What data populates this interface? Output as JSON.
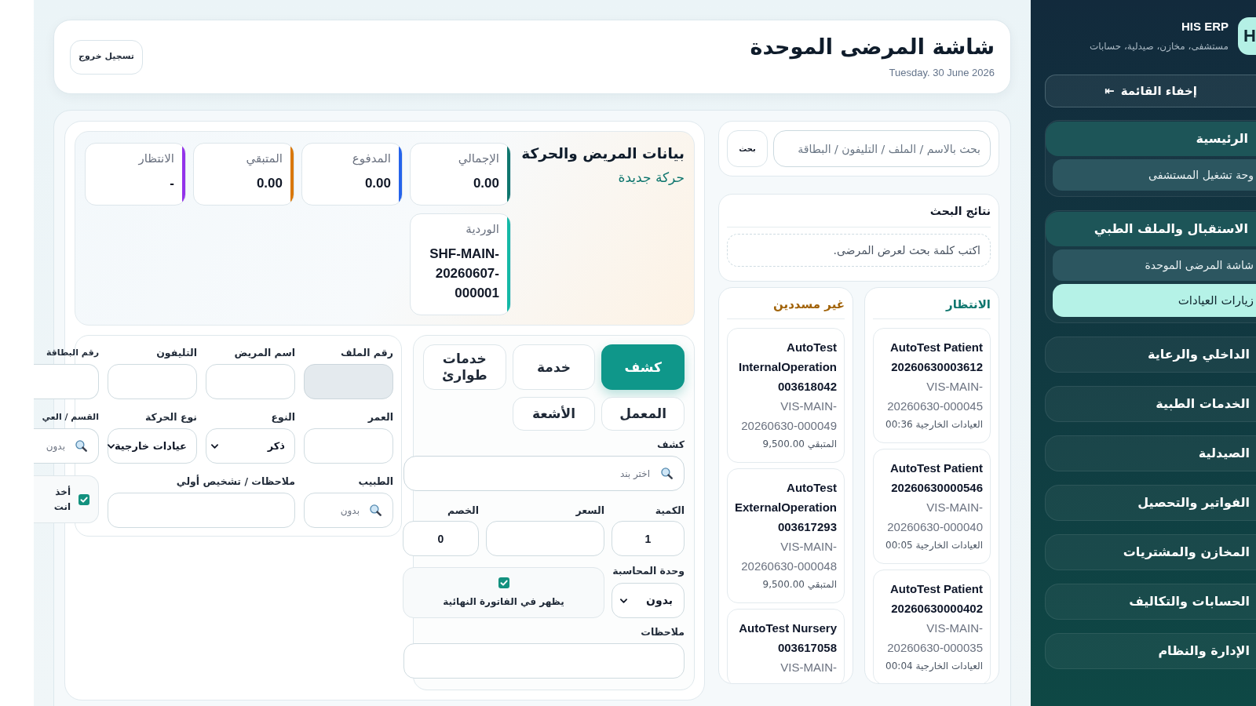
{
  "sidebar": {
    "brand": {
      "logo": "H",
      "title": "HIS ERP",
      "subtitle": "مستشفى، مخازن، صيدلية، حسابات"
    },
    "toggle_button": {
      "icon": "⇤",
      "label": "إخفاء القائمة"
    },
    "groups": [
      {
        "label": "الرئيسية",
        "expanded": true,
        "children": [
          {
            "label": "وحة تشغيل المستشفى",
            "selected": false
          }
        ]
      },
      {
        "label": "الاستقبال والملف الطبي",
        "expanded": true,
        "children": [
          {
            "label": "شاشة المرضى الموحدة",
            "selected": false
          },
          {
            "label": "زيارات العيادات",
            "selected": true
          }
        ]
      },
      {
        "label": "الداخلي والرعاية",
        "expanded": false
      },
      {
        "label": "الخدمات الطبية",
        "expanded": false
      },
      {
        "label": "الصيدلية",
        "expanded": false
      },
      {
        "label": "الفواتير والتحصيل",
        "expanded": false
      },
      {
        "label": "المخازن والمشتريات",
        "expanded": false
      },
      {
        "label": "الحسابات والتكاليف",
        "expanded": false
      },
      {
        "label": "الإدارة والنظام",
        "expanded": false
      }
    ]
  },
  "header": {
    "title": "شاشة المرضى الموحدة",
    "date": "Tuesday. 30 June 2026",
    "logout_button": "تسجيل خروج"
  },
  "search": {
    "placeholder": "بحث بالاسم / الملف / التليفون / البطاقة",
    "button": "بحث"
  },
  "search_results": {
    "title": "نتائج البحث",
    "empty_message": "اكتب كلمة بحث لعرض المرضى."
  },
  "queues": [
    {
      "title": "الانتظار",
      "color": "#0f766e",
      "items": [
        {
          "name": "AutoTest Patient 20260630003612",
          "visit": "VIS-MAIN-20260630-000045",
          "detail": "العيادات الخارجية 00:36"
        },
        {
          "name": "AutoTest Patient 20260630000546",
          "visit": "VIS-MAIN-20260630-000040",
          "detail": "العيادات الخارجية 00:05"
        },
        {
          "name": "AutoTest Patient 20260630000402",
          "visit": "VIS-MAIN-20260630-000035",
          "detail": "العيادات الخارجية 00:04"
        }
      ]
    },
    {
      "title": "غير مسددين",
      "color": "#a16207",
      "items": [
        {
          "name": "AutoTest InternalOperation 003618042",
          "visit": "VIS-MAIN-20260630-000049",
          "detail": "المتبقي 9,500.00"
        },
        {
          "name": "AutoTest ExternalOperation 003617293",
          "visit": "VIS-MAIN-20260630-000048",
          "detail": "المتبقي 9,500.00"
        },
        {
          "name": "AutoTest Nursery 003617058",
          "visit": "VIS-MAIN-"
        }
      ]
    }
  ],
  "patient_panel": {
    "title": "بيانات المريض والحركة",
    "subtitle": "حركة جديدة",
    "stats": [
      {
        "label": "الإجمالي",
        "value": "0.00",
        "color": "#0f766e"
      },
      {
        "label": "المدفوع",
        "value": "0.00",
        "color": "#2563eb"
      },
      {
        "label": "المتبقي",
        "value": "0.00",
        "color": "#d97706"
      },
      {
        "label": "الانتظار",
        "value": "-",
        "color": "#9333ea"
      },
      {
        "label": "الوردية",
        "value": "SHF-MAIN-20260607-000001",
        "color": "#14b8a6"
      }
    ]
  },
  "service_panel": {
    "tabs": [
      {
        "label": "كشف",
        "selected": true
      },
      {
        "label": "خدمة",
        "selected": false
      },
      {
        "label": "خدمات طوارئ",
        "selected": false
      },
      {
        "label": "المعمل",
        "selected": false
      },
      {
        "label": "الأشعة",
        "selected": false
      }
    ],
    "item_field": {
      "label": "كشف",
      "placeholder": "اختر بند"
    },
    "quantity": {
      "label": "الكمية",
      "value": "1"
    },
    "price": {
      "label": "السعر"
    },
    "discount": {
      "label": "الخصم",
      "value": "0"
    },
    "accounting_unit": {
      "label": "وحدة المحاسبة",
      "value": "بدون"
    },
    "show_on_invoice": {
      "label": "يظهر في الفاتورة النهائية",
      "checked": true
    },
    "notes": {
      "label": "ملاحظات"
    }
  },
  "patient_form": {
    "fields": [
      {
        "kind": "input",
        "label": "رقم الملف",
        "disabled": true
      },
      {
        "kind": "input",
        "label": "اسم المريض",
        "disabled": false
      },
      {
        "kind": "input",
        "label": "التليفون",
        "disabled": false
      },
      {
        "kind": "input",
        "label": "رقم البطاقة",
        "disabled": false
      },
      {
        "kind": "input",
        "label": "العمر",
        "disabled": false
      },
      {
        "kind": "select",
        "label": "النوع",
        "value": "ذكر"
      },
      {
        "kind": "select",
        "label": "نوع الحركة",
        "value": "عيادات خارجية"
      },
      {
        "kind": "search",
        "label": "القسم / العي",
        "placeholder": "بدون"
      },
      {
        "kind": "search",
        "label": "الطبيب",
        "placeholder": "بدون"
      },
      {
        "kind": "textarea",
        "label": "ملاحظات / تشخيص أولي"
      },
      {
        "kind": "checkbox",
        "label": "أخذ انت",
        "checked": true
      }
    ]
  }
}
